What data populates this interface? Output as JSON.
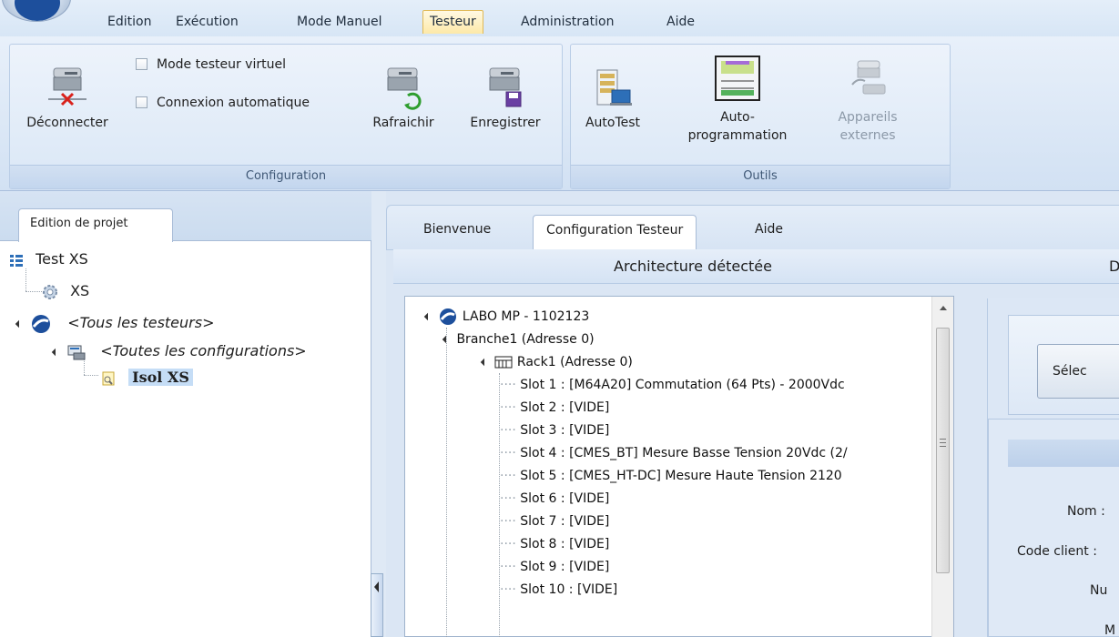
{
  "menu": {
    "items": [
      "Edition",
      "Exécution",
      "Mode Manuel",
      "Testeur",
      "Administration",
      "Aide"
    ],
    "active": "Testeur"
  },
  "ribbon": {
    "configuration": {
      "caption": "Configuration",
      "disconnect": "Déconnecter",
      "virtual_mode": "Mode testeur virtuel",
      "auto_connect": "Connexion automatique",
      "refresh": "Rafraichir",
      "save": "Enregistrer"
    },
    "tools": {
      "caption": "Outils",
      "autotest": "AutoTest",
      "autoprog_line1": "Auto-",
      "autoprog_line2": "programmation",
      "external_line1": "Appareils",
      "external_line2": "externes"
    }
  },
  "left": {
    "tab": "Edition de projet",
    "tree": {
      "root": "Test XS",
      "xs": "XS",
      "all_testers": "<Tous les testeurs>",
      "all_configs": "<Toutes les configurations>",
      "selected": "Isol XS"
    }
  },
  "right": {
    "tabs": [
      "Bienvenue",
      "Configuration Testeur",
      "Aide"
    ],
    "active_tab": "Configuration Testeur",
    "header_title": "Architecture détectée",
    "header_trunc": "D",
    "arch": {
      "labo": "LABO MP - 1102123",
      "branche": "Branche1 (Adresse 0)",
      "rack": "Rack1 (Adresse 0)",
      "slots": [
        "Slot 1 : [M64A20] Commutation (64 Pts) - 2000Vdc",
        "Slot 2 : [VIDE]",
        "Slot 3 : [VIDE]",
        "Slot 4 : [CMES_BT] Mesure Basse Tension 20Vdc (2/",
        "Slot 5 : [CMES_HT-DC] Mesure Haute Tension 2120",
        "Slot 6 : [VIDE]",
        "Slot 7 : [VIDE]",
        "Slot 8 : [VIDE]",
        "Slot 9 : [VIDE]",
        "Slot 10 : [VIDE]"
      ]
    },
    "side": {
      "select_button": "Sélec",
      "nom": "Nom :",
      "code_client": "Code client :",
      "nu": "Nu",
      "m": "M"
    }
  },
  "colors": {
    "ribbon_bg": "#dae7f6",
    "selection": "#c5ddf6",
    "active_menu": "#fde9a8",
    "brand_blue": "#1d4f9c"
  }
}
